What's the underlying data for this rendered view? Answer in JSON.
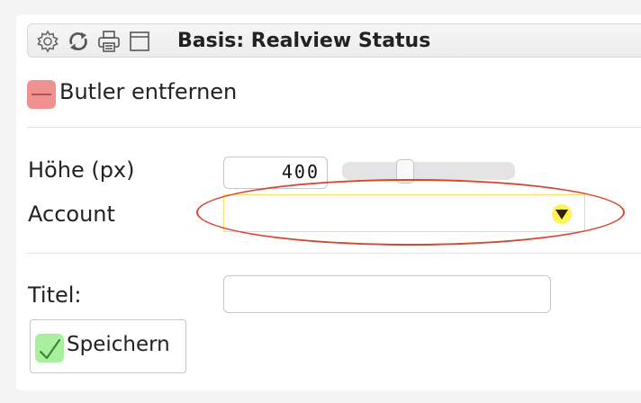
{
  "panel": {
    "title": "Basis: Realview Status",
    "toolbar_icons": [
      "gear-icon",
      "refresh-icon",
      "print-icon",
      "window-icon"
    ]
  },
  "remove_button": {
    "label": "Butler entfernen",
    "icon": "minus-icon",
    "color": "#ef9191"
  },
  "form": {
    "height": {
      "label": "Höhe (px)",
      "value": "400",
      "slider_fraction": 0.35
    },
    "account": {
      "label": "Account",
      "value": "",
      "arrow_icon": "triangle-down-icon"
    },
    "title": {
      "label": "Titel:",
      "value": ""
    }
  },
  "save_button": {
    "label": "Speichern",
    "icon": "checkmark-icon",
    "color": "#a8f0a0"
  },
  "annotation": {
    "color": "#d9442e"
  }
}
